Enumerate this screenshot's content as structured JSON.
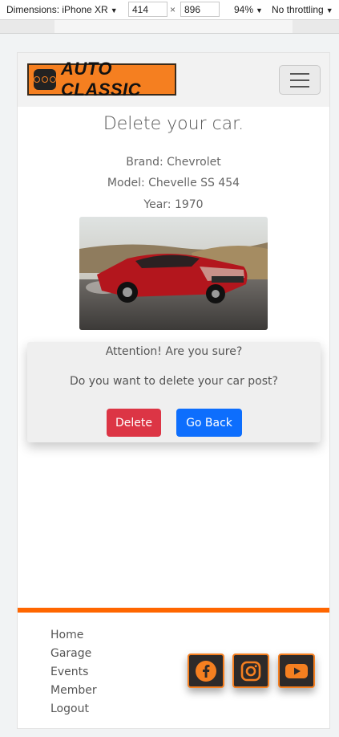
{
  "devtools": {
    "device_label": "Dimensions: iPhone XR",
    "width": "414",
    "times": "×",
    "height": "896",
    "zoom": "94%",
    "throttling": "No throttling"
  },
  "navbar": {
    "brand": "AUTO CLASSIC",
    "menu_icon": "hamburger-menu-icon"
  },
  "page": {
    "title": "Delete your car.",
    "brand": "Brand: Chevrolet",
    "model": "Model: Chevelle SS 454",
    "year": "Year: 1970"
  },
  "confirm": {
    "attention": "Attention! Are you sure?",
    "question": "Do you want to delete your car post?",
    "delete_label": "Delete",
    "back_label": "Go Back"
  },
  "footer": {
    "links": [
      "Home",
      "Garage",
      "Events",
      "Member",
      "Logout"
    ],
    "social": [
      "facebook-icon",
      "instagram-icon",
      "youtube-icon"
    ]
  },
  "colors": {
    "accent_orange": "#ff6600",
    "delete_red": "#dc3545",
    "back_blue": "#0d6efd"
  }
}
